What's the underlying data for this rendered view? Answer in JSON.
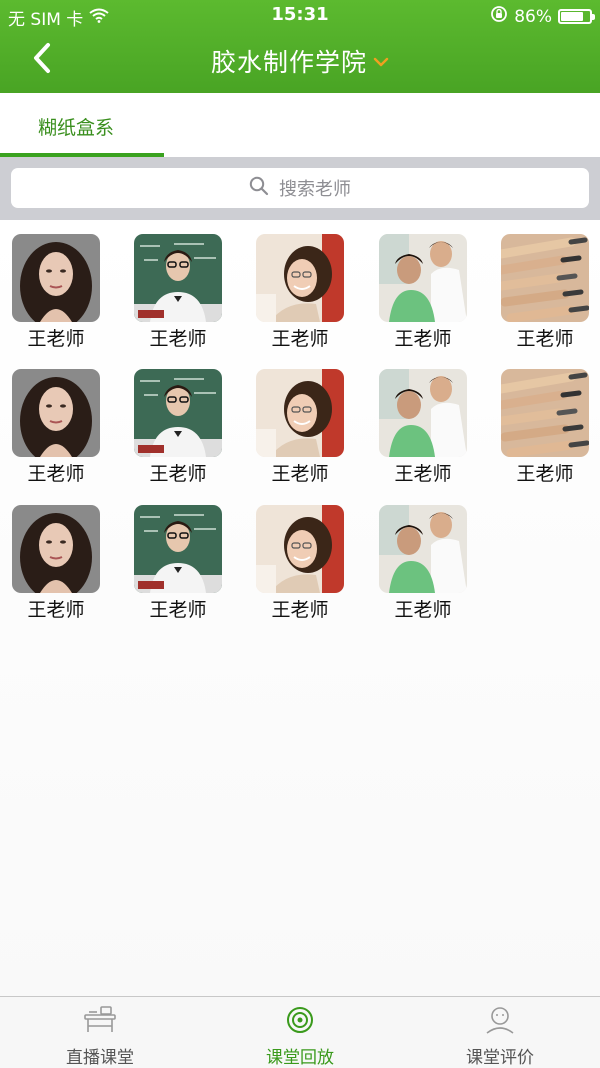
{
  "status_bar": {
    "carrier": "无 SIM 卡",
    "time": "15:31",
    "battery": "86%",
    "battery_level": 0.86
  },
  "header": {
    "back_icon": "chevron-left-icon",
    "title": "胶水制作学院",
    "dropdown_icon": "chevron-down-icon",
    "dropdown_color": "#f0a020"
  },
  "tabs": [
    {
      "label": "糊纸盒系",
      "selected": true
    }
  ],
  "search": {
    "icon": "search-icon",
    "placeholder": "搜索老师"
  },
  "teachers": [
    {
      "name": "王老师",
      "photo": "portrait-woman-dark-hair"
    },
    {
      "name": "王老师",
      "photo": "girl-with-glasses-chalkboard"
    },
    {
      "name": "王老师",
      "photo": "smiling-woman-with-glasses"
    },
    {
      "name": "王老师",
      "photo": "students-studying"
    },
    {
      "name": "王老师",
      "photo": "colored-pencils"
    },
    {
      "name": "王老师",
      "photo": "portrait-woman-dark-hair"
    },
    {
      "name": "王老师",
      "photo": "girl-with-glasses-chalkboard"
    },
    {
      "name": "王老师",
      "photo": "smiling-woman-with-glasses"
    },
    {
      "name": "王老师",
      "photo": "students-studying"
    },
    {
      "name": "王老师",
      "photo": "colored-pencils"
    },
    {
      "name": "王老师",
      "photo": "portrait-woman-dark-hair"
    },
    {
      "name": "王老师",
      "photo": "girl-with-glasses-chalkboard"
    },
    {
      "name": "王老师",
      "photo": "smiling-woman-with-glasses"
    },
    {
      "name": "王老师",
      "photo": "students-studying"
    }
  ],
  "tabbar": {
    "items": [
      {
        "label": "直播课堂",
        "icon": "classroom-desk-icon",
        "active": false
      },
      {
        "label": "课堂回放",
        "icon": "replay-disc-icon",
        "active": true
      },
      {
        "label": "课堂评价",
        "icon": "user-evaluation-icon",
        "active": false
      }
    ]
  },
  "colors": {
    "brand_green": "#4eae28",
    "active_green": "#3a9a1c",
    "inactive_gray": "#555555"
  }
}
